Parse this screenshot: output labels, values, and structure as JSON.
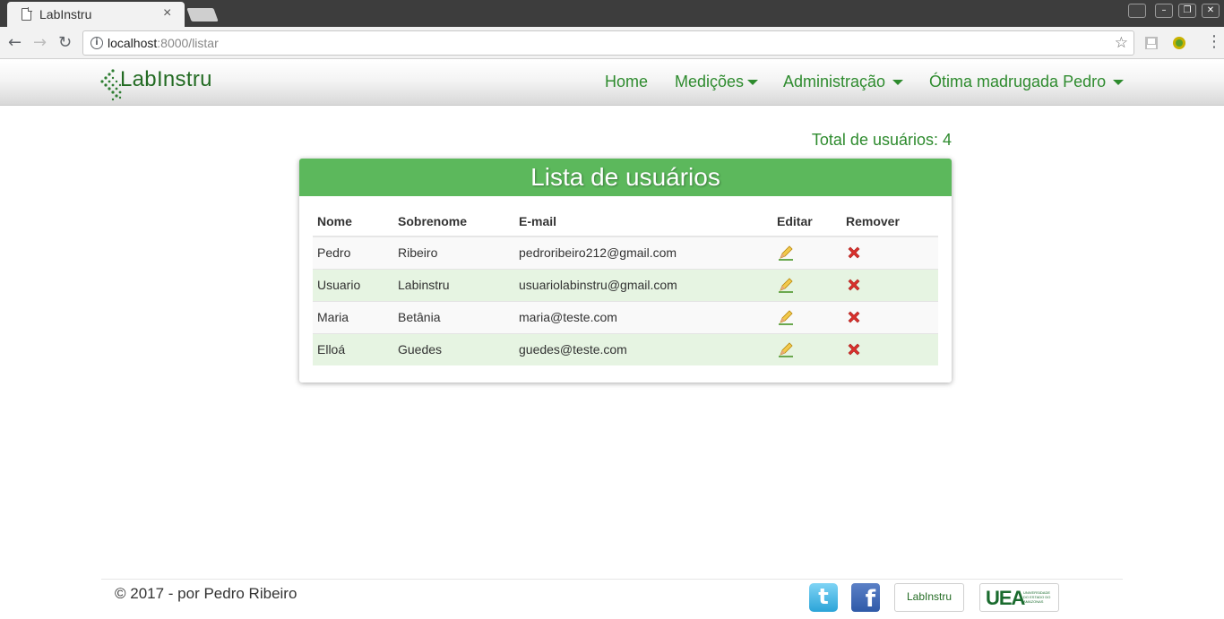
{
  "browser": {
    "tab_title": "LabInstru",
    "url_host": "localhost",
    "url_path": ":8000/listar",
    "back_glyph": "←",
    "forward_glyph": "→",
    "reload_glyph": "↻",
    "star_glyph": "☆",
    "close_glyph": "×",
    "win_controls": [
      "👤",
      "–",
      "❐",
      "✕"
    ]
  },
  "header": {
    "brand": "LabInstru",
    "nav": {
      "home": "Home",
      "medicoes": "Medições",
      "administracao": "Administração",
      "user_greeting": "Ótima madrugada Pedro"
    }
  },
  "main": {
    "total_label": "Total de usuários: 4",
    "panel_title": "Lista de usuários",
    "columns": [
      "Nome",
      "Sobrenome",
      "E-mail",
      "Editar",
      "Remover"
    ],
    "rows": [
      {
        "nome": "Pedro",
        "sobrenome": "Ribeiro",
        "email": "pedroribeiro212@gmail.com"
      },
      {
        "nome": "Usuario",
        "sobrenome": "Labinstru",
        "email": "usuariolabinstru@gmail.com"
      },
      {
        "nome": "Maria",
        "sobrenome": "Betânia",
        "email": "maria@teste.com"
      },
      {
        "nome": "Elloá",
        "sobrenome": "Guedes",
        "email": "guedes@teste.com"
      }
    ],
    "row_icons": {
      "edit": "pencil-icon",
      "remove": "red-x-icon"
    }
  },
  "footer": {
    "copyright": "© 2017 - por Pedro Ribeiro",
    "twitter_glyph": "t",
    "facebook_glyph": "f",
    "labinstru_badge": "LabInstru",
    "uea_text": "UEA",
    "uea_small": "UNIVERSIDADE DO ESTADO DO AMAZONAS"
  },
  "colors": {
    "accent": "#2e8b2e",
    "panel_header": "#5cb85c",
    "row_alt": "#e6f4e2",
    "remove": "#d9302c"
  }
}
